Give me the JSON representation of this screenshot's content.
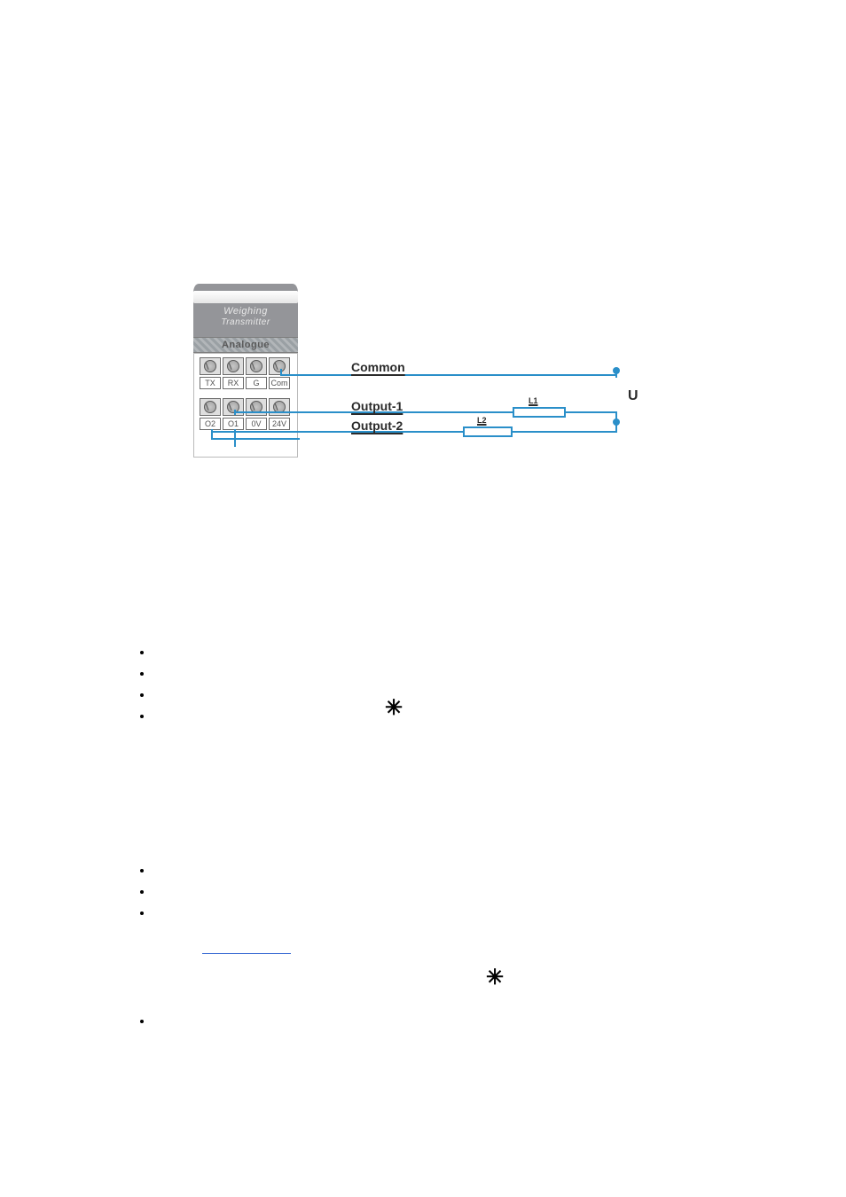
{
  "module": {
    "title_line1": "Weighing",
    "title_line2": "Transmitter",
    "band": "Analogue",
    "row1": [
      "TX",
      "RX",
      "G",
      "Com"
    ],
    "row2": [
      "O2",
      "O1",
      "0V",
      "24V"
    ]
  },
  "nets": {
    "common": "Common",
    "out1": "Output-1",
    "out2": "Output-2",
    "U": "U",
    "L1": "L1",
    "L2": "L2"
  },
  "glyphs": {
    "six_spoke": "✳"
  }
}
